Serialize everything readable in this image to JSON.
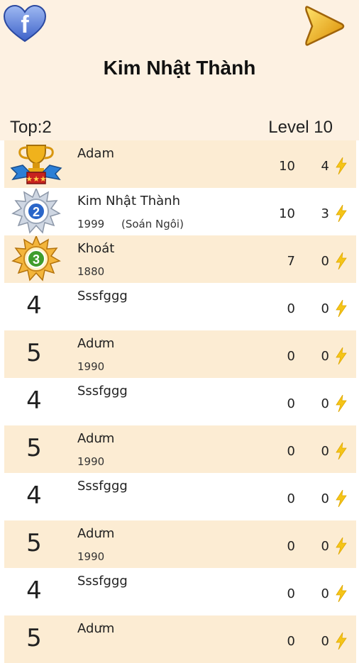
{
  "header": {
    "title": "Kim Nhật Thành",
    "top_label": "Top:2",
    "level_label": "Level 10",
    "facebook_icon": "facebook-heart-icon",
    "play_icon": "play-arrow-icon"
  },
  "colors": {
    "header_bg": "#fdf1e2",
    "row_alt": "#fcecd3",
    "bolt": "#f5c518"
  },
  "rows": [
    {
      "rank": "1",
      "medal": "gold",
      "name": "Adam",
      "year": "",
      "note": "",
      "score": "10",
      "bolts": "4"
    },
    {
      "rank": "2",
      "medal": "silver",
      "name": "Kim Nhật Thành",
      "year": "1999",
      "note": "(Soán Ngôi)",
      "score": "10",
      "bolts": "3"
    },
    {
      "rank": "3",
      "medal": "bronze",
      "name": "Khoát",
      "year": "1880",
      "note": "",
      "score": "7",
      "bolts": "0"
    },
    {
      "rank": "4",
      "medal": "",
      "name": "Sssfggg",
      "year": "",
      "note": "",
      "score": "0",
      "bolts": "0"
    },
    {
      "rank": "5",
      "medal": "",
      "name": "Adưm",
      "year": "1990",
      "note": "",
      "score": "0",
      "bolts": "0"
    },
    {
      "rank": "4",
      "medal": "",
      "name": "Sssfggg",
      "year": "",
      "note": "",
      "score": "0",
      "bolts": "0"
    },
    {
      "rank": "5",
      "medal": "",
      "name": "Adưm",
      "year": "1990",
      "note": "",
      "score": "0",
      "bolts": "0"
    },
    {
      "rank": "4",
      "medal": "",
      "name": "Sssfggg",
      "year": "",
      "note": "",
      "score": "0",
      "bolts": "0"
    },
    {
      "rank": "5",
      "medal": "",
      "name": "Adưm",
      "year": "1990",
      "note": "",
      "score": "0",
      "bolts": "0"
    },
    {
      "rank": "4",
      "medal": "",
      "name": "Sssfggg",
      "year": "",
      "note": "",
      "score": "0",
      "bolts": "0"
    },
    {
      "rank": "5",
      "medal": "",
      "name": "Adưm",
      "year": "",
      "note": "",
      "score": "0",
      "bolts": "0"
    }
  ]
}
